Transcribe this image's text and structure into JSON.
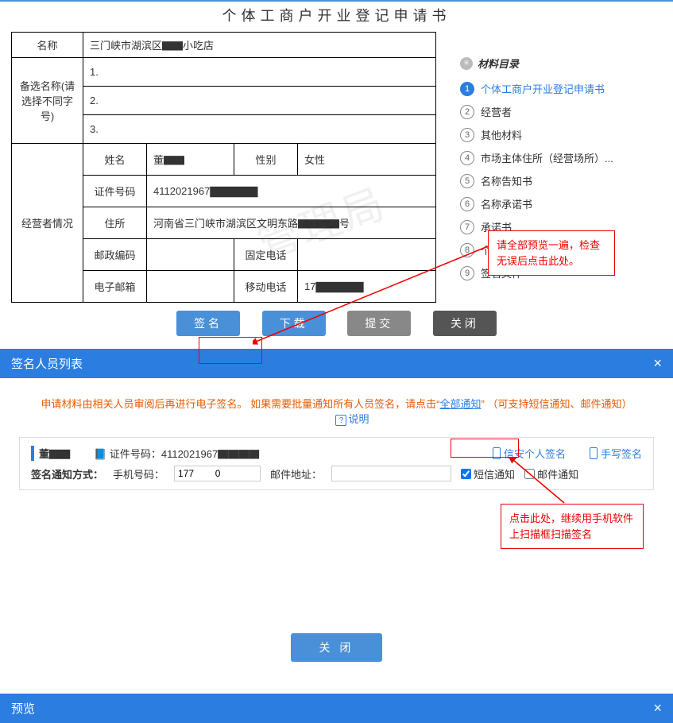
{
  "page_title": "个体工商户开业登记申请书",
  "form": {
    "name_label": "名称",
    "name_value": "三门峡市湖滨区▇▇小吃店",
    "alt_name_label": "备选名称(请选择不同字号)",
    "alt1": "1.",
    "alt2": "2.",
    "alt3": "3.",
    "operator_label": "经营者情况",
    "fld_name": "姓名",
    "val_name": "董▇▇",
    "fld_gender": "性别",
    "val_gender": "女性",
    "fld_id": "证件号码",
    "val_id": "4112021967▇▇▇▇▇▇",
    "fld_addr": "住所",
    "val_addr": "河南省三门峡市湖滨区文明东路▇▇▇▇号",
    "fld_zip": "邮政编码",
    "fld_tel": "固定电话",
    "fld_email": "电子邮箱",
    "fld_mobile": "移动电话",
    "val_mobile": "17▇▇▇▇▇▇"
  },
  "toc": {
    "title": "材料目录",
    "items": [
      {
        "n": "1",
        "label": "个体工商户开业登记申请书",
        "active": true
      },
      {
        "n": "2",
        "label": "经营者"
      },
      {
        "n": "3",
        "label": "其他材料"
      },
      {
        "n": "4",
        "label": "市场主体住所（经营场所）..."
      },
      {
        "n": "5",
        "label": "名称告知书"
      },
      {
        "n": "6",
        "label": "名称承诺书"
      },
      {
        "n": "7",
        "label": "承诺书"
      },
      {
        "n": "8",
        "label": "个体户简易登记住所承诺书"
      },
      {
        "n": "9",
        "label": "签名文件"
      }
    ]
  },
  "buttons": {
    "sign": "签名",
    "download": "下载",
    "submit": "提交",
    "close": "关闭"
  },
  "callout1": "请全部预览一遍，检查无误后点击此处。",
  "callout2": "点击此处，继续用手机软件上扫描框扫描签名",
  "sign_panel": {
    "header": "签名人员列表",
    "hint_pre": "申请材料由相关人员审阅后再进行电子签名。 如果需要批量通知所有人员签名，请点击“",
    "hint_link": "全部通知",
    "hint_post": "”  （可支持短信通知、邮件通知）",
    "help": "说明",
    "person": "董▇▇",
    "id_label": "证件号码：",
    "id_value": "4112021967▇▇▇▇",
    "xinan": "信安个人签名",
    "hand": "手写签名",
    "notify_label": "签名通知方式：",
    "phone_label": "手机号码：",
    "phone_value": "177        0",
    "email_label": "邮件地址：",
    "sms_notify": "短信通知",
    "mail_notify": "邮件通知",
    "close_btn": "关 闭"
  },
  "preview_header": "预览",
  "watermark": "管理局"
}
